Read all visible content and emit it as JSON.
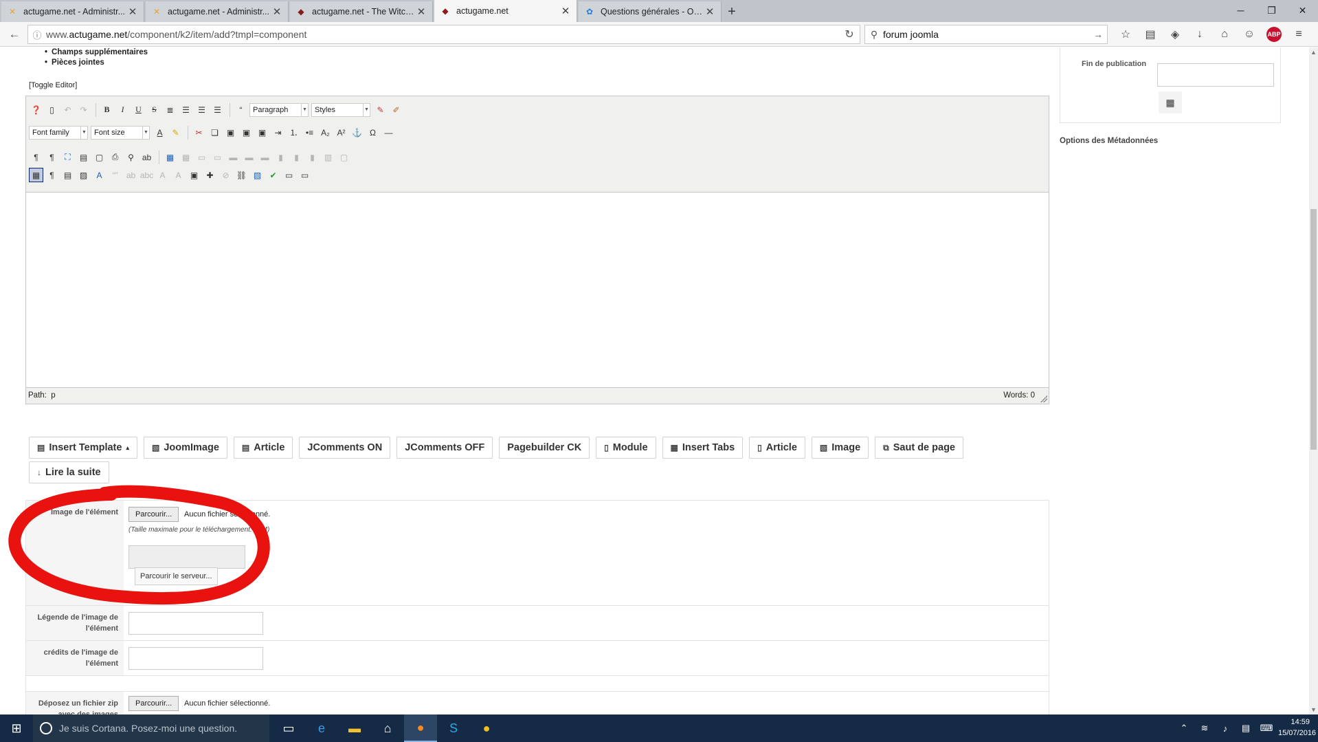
{
  "browser": {
    "tabs": [
      {
        "title": "actugame.net - Administr...",
        "favicon": "joomla-x-icon",
        "active": false
      },
      {
        "title": "actugame.net - Administr...",
        "favicon": "joomla-x-icon",
        "active": false
      },
      {
        "title": "actugame.net - The Witch...",
        "favicon": "actugame-icon",
        "active": false
      },
      {
        "title": "actugame.net",
        "favicon": "actugame-icon",
        "active": true
      },
      {
        "title": "Questions générales - Ouv...",
        "favicon": "joomla-icon",
        "active": false
      }
    ],
    "new_tab": "+",
    "url_prefix": "www.",
    "url_domain": "actugame.net",
    "url_path": "/component/k2/item/add?tmpl=component",
    "search_value": "forum joomla",
    "adblock_label": "ABP"
  },
  "page": {
    "bullets": [
      "Champs supplémentaires",
      "Pièces jointes"
    ],
    "toggle_editor": "[Toggle Editor]",
    "editor": {
      "format_select": "Paragraph",
      "styles_select": "Styles",
      "font_family": "Font family",
      "font_size": "Font size",
      "path_label": "Path:",
      "path_value": "p",
      "words": "Words: 0"
    },
    "plugin_buttons": [
      {
        "label": "Insert Template",
        "icon": "template-icon",
        "caret": "▴"
      },
      {
        "label": "JoomImage",
        "icon": "image-icon"
      },
      {
        "label": "Article",
        "icon": "article-icon"
      },
      {
        "label": "JComments ON",
        "icon": ""
      },
      {
        "label": "JComments OFF",
        "icon": ""
      },
      {
        "label": "Pagebuilder CK",
        "icon": ""
      },
      {
        "label": "Module",
        "icon": "file-icon"
      },
      {
        "label": "Insert Tabs",
        "icon": "tabs-icon"
      },
      {
        "label": "Article",
        "icon": "file-icon"
      },
      {
        "label": "Image",
        "icon": "image-icon"
      },
      {
        "label": "Saut de page",
        "icon": "pagebreak-icon"
      },
      {
        "label": "Lire la suite",
        "icon": "arrow-down-icon"
      }
    ],
    "image_section": {
      "image_label": "Image de l'élément",
      "browse_button": "Parcourir...",
      "no_file": "Aucun fichier sélectionné.",
      "max_size_hint": "(Taille maximale pour le téléchargement: 64M)",
      "browse_server_button": "Parcourir le serveur...",
      "caption_label": "Légende de l'image de l'élément",
      "credits_label": "crédits de l'image de l'élément",
      "zip_label": "Déposez un fichier zip avec des images",
      "zip_browse_button": "Parcourir...",
      "zip_no_file": "Aucun fichier sélectionné."
    },
    "sidebar": {
      "end_publication_label": "Fin de publication",
      "metadata_title": "Options des Métadonnées"
    }
  },
  "taskbar": {
    "cortana_placeholder": "Je suis Cortana. Posez-moi une question.",
    "time": "14:59",
    "date": "15/07/2016"
  },
  "colors": {
    "annotation": "#e8130f",
    "taskbar": "#152a45"
  }
}
